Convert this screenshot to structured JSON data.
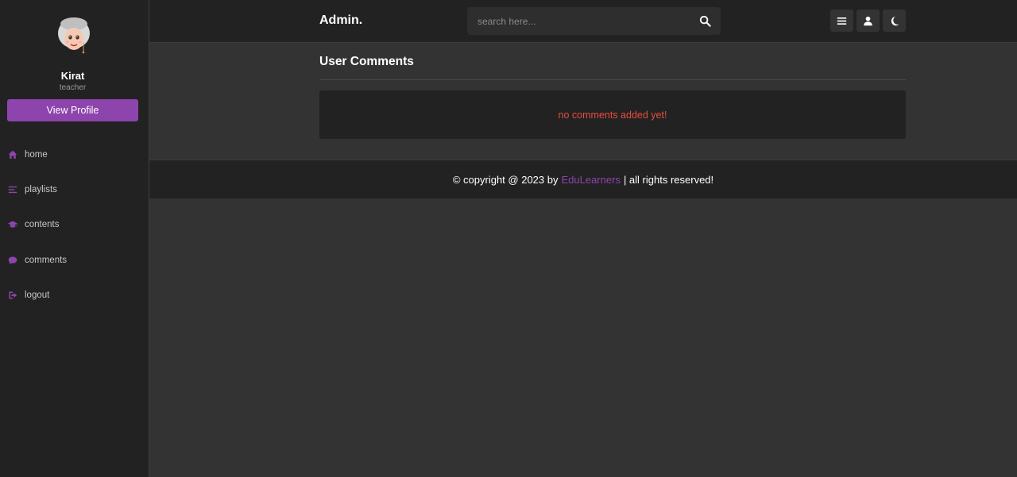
{
  "header": {
    "brand": "Admin.",
    "search_placeholder": "search here...",
    "icons": [
      "menu-icon",
      "user-icon",
      "moon-icon",
      "search-icon"
    ]
  },
  "sidebar": {
    "profile": {
      "name": "Kirat",
      "role": "teacher",
      "button_label": "View Profile"
    },
    "items": [
      {
        "label": "home",
        "icon": "home-icon"
      },
      {
        "label": "playlists",
        "icon": "list-icon"
      },
      {
        "label": "contents",
        "icon": "graduation-cap-icon"
      },
      {
        "label": "comments",
        "icon": "comment-icon"
      },
      {
        "label": "logout",
        "icon": "logout-icon"
      }
    ]
  },
  "main": {
    "title": "User Comments",
    "empty_message": "no comments added yet!"
  },
  "footer": {
    "prefix": "© copyright @ 2023 by",
    "brand": "EduLearners",
    "suffix": "| all rights reserved!"
  },
  "colors": {
    "accent": "#8e44ad",
    "error": "#e74c3c",
    "panel": "#222222",
    "background": "#333333"
  }
}
